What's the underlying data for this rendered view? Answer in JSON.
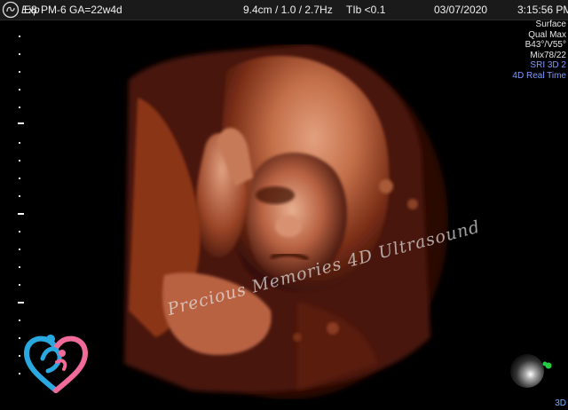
{
  "header": {
    "logo_icon": "ge-logo-icon",
    "logo_eb": "E8",
    "logo_exp": "Exp",
    "patient": "PM-6  GA=22w4d",
    "probe": "9.4cm / 1.0 / 2.7Hz",
    "tib": "TIb <0.1",
    "date": "03/07/2020",
    "time": "3:15:56 PM"
  },
  "params": {
    "line1": "Surface",
    "line2": "Qual Max",
    "line3": "B43°/V55°",
    "line4": "Mix78/22",
    "line5": "SRI 3D 2",
    "line6": "4D Real Time"
  },
  "watermark": "Precious Memories 4D Ultrasound",
  "footer": {
    "mode": "3D"
  },
  "colors": {
    "accent_blue": "#7d9bff",
    "skin": "#c4704a",
    "logo_blue": "#2aa8e0",
    "logo_pink": "#f06a9a"
  }
}
